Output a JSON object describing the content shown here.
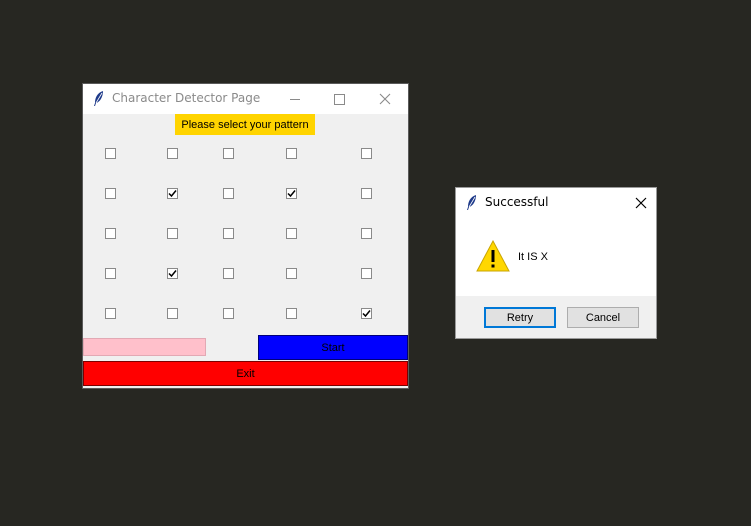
{
  "main_window": {
    "title": "Character Detector Page",
    "banner": "Please select your pattern",
    "start_label": "Start",
    "exit_label": "Exit",
    "grid": [
      [
        false,
        false,
        false,
        false,
        false
      ],
      [
        false,
        true,
        false,
        true,
        false
      ],
      [
        false,
        false,
        false,
        false,
        false
      ],
      [
        false,
        true,
        false,
        false,
        false
      ],
      [
        false,
        false,
        false,
        false,
        true
      ]
    ]
  },
  "dialog": {
    "title": "Successful",
    "message": "It IS  X",
    "retry_label": "Retry",
    "cancel_label": "Cancel"
  },
  "colors": {
    "desktop": "#272722",
    "banner": "#ffd400",
    "pink_bar": "#ffc0cb",
    "start": "#0000ff",
    "exit": "#ff0000"
  },
  "icons": {
    "app": "feather-icon",
    "warning": "warning-icon"
  }
}
